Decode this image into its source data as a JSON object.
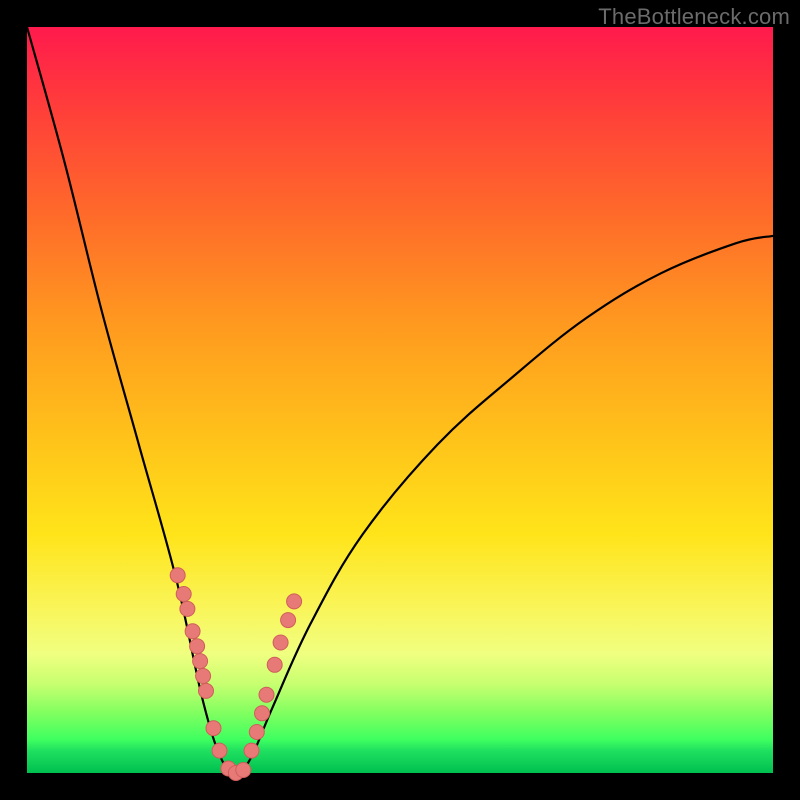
{
  "watermark": "TheBottleneck.com",
  "colors": {
    "background": "#000000",
    "dot_fill": "#e77a77",
    "dot_stroke": "#cf5e5b",
    "curve": "#000000",
    "watermark": "#6b6b6b"
  },
  "chart_data": {
    "type": "line",
    "title": "",
    "xlabel": "",
    "ylabel": "",
    "xlim": [
      0,
      1
    ],
    "ylim": [
      0,
      1
    ],
    "grid": false,
    "legend": false,
    "annotations": [
      "TheBottleneck.com"
    ],
    "series": [
      {
        "name": "bottleneck-curve",
        "note": "V-shaped curve; y≈0 near x≈0.28, rising steeply to the left edge (y≈1 at x=0) and rising with decreasing slope to the right (y≈0.72 at x=1).",
        "x": [
          0.0,
          0.05,
          0.1,
          0.15,
          0.2,
          0.235,
          0.26,
          0.28,
          0.3,
          0.33,
          0.38,
          0.45,
          0.55,
          0.65,
          0.75,
          0.85,
          0.95,
          1.0
        ],
        "y": [
          1.0,
          0.82,
          0.62,
          0.44,
          0.26,
          0.1,
          0.02,
          0.0,
          0.02,
          0.09,
          0.2,
          0.32,
          0.44,
          0.53,
          0.61,
          0.67,
          0.71,
          0.72
        ]
      }
    ],
    "markers": {
      "name": "highlighted-points",
      "note": "pink dots clustered along both arms near the valley floor",
      "x": [
        0.202,
        0.21,
        0.215,
        0.222,
        0.228,
        0.232,
        0.236,
        0.24,
        0.25,
        0.258,
        0.27,
        0.28,
        0.29,
        0.301,
        0.308,
        0.315,
        0.321,
        0.332,
        0.34,
        0.35,
        0.358
      ],
      "y": [
        0.265,
        0.24,
        0.22,
        0.19,
        0.17,
        0.15,
        0.13,
        0.11,
        0.06,
        0.03,
        0.006,
        0.0,
        0.004,
        0.03,
        0.055,
        0.08,
        0.105,
        0.145,
        0.175,
        0.205,
        0.23
      ]
    }
  }
}
